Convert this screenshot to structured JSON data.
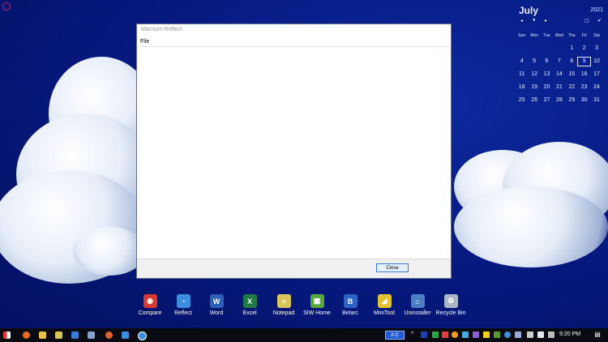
{
  "calendar": {
    "month": "July",
    "year": "2021",
    "nav": {
      "prev": "◂",
      "dot": "●",
      "next": "▸",
      "box": "▢",
      "check": "✔"
    },
    "weekdays": [
      "Sun",
      "Mon",
      "Tue",
      "Wed",
      "Thu",
      "Fri",
      "Sat"
    ],
    "weeks": [
      [
        "",
        "",
        "",
        "",
        "1",
        "2",
        "3"
      ],
      [
        "4",
        "5",
        "6",
        "7",
        "8",
        "9",
        "10"
      ],
      [
        "11",
        "12",
        "13",
        "14",
        "15",
        "16",
        "17"
      ],
      [
        "18",
        "19",
        "20",
        "21",
        "22",
        "23",
        "24"
      ],
      [
        "25",
        "26",
        "27",
        "28",
        "29",
        "30",
        "31"
      ]
    ],
    "today": "9"
  },
  "window": {
    "title": "Macrium Reflect",
    "menu": "File",
    "close_label": "Close"
  },
  "dock": {
    "items": [
      {
        "label": "Compare",
        "icon": "compare-icon",
        "color": "#d63a2f",
        "glyph": "◉"
      },
      {
        "label": "Reflect",
        "icon": "reflect-icon",
        "color": "#3c8de0",
        "glyph": "◔"
      },
      {
        "label": "Word",
        "icon": "word-icon",
        "color": "#2b5fb4",
        "glyph": "W"
      },
      {
        "label": "Excel",
        "icon": "excel-icon",
        "color": "#1e7b45",
        "glyph": "X"
      },
      {
        "label": "Notepad",
        "icon": "notepad-icon",
        "color": "#d8c65a",
        "glyph": "≡"
      },
      {
        "label": "SIW Home",
        "icon": "siw-home-icon",
        "color": "#57a83f",
        "glyph": "▦"
      },
      {
        "label": "Belarc",
        "icon": "belarc-icon",
        "color": "#2d62c6",
        "glyph": "B"
      },
      {
        "label": "MiniTool",
        "icon": "minitool-icon",
        "color": "#e0c12e",
        "glyph": "◢"
      },
      {
        "label": "Uninstaller",
        "icon": "uninstaller-icon",
        "color": "#4a7dc4",
        "glyph": "⌂"
      },
      {
        "label": "Recycle Bin",
        "icon": "recycle-bin-icon",
        "color": "#aab6c8",
        "glyph": "♻"
      }
    ]
  },
  "taskbar": {
    "ac_label": "A:C",
    "time": "9:20 PM",
    "notification_glyph": "▤"
  }
}
